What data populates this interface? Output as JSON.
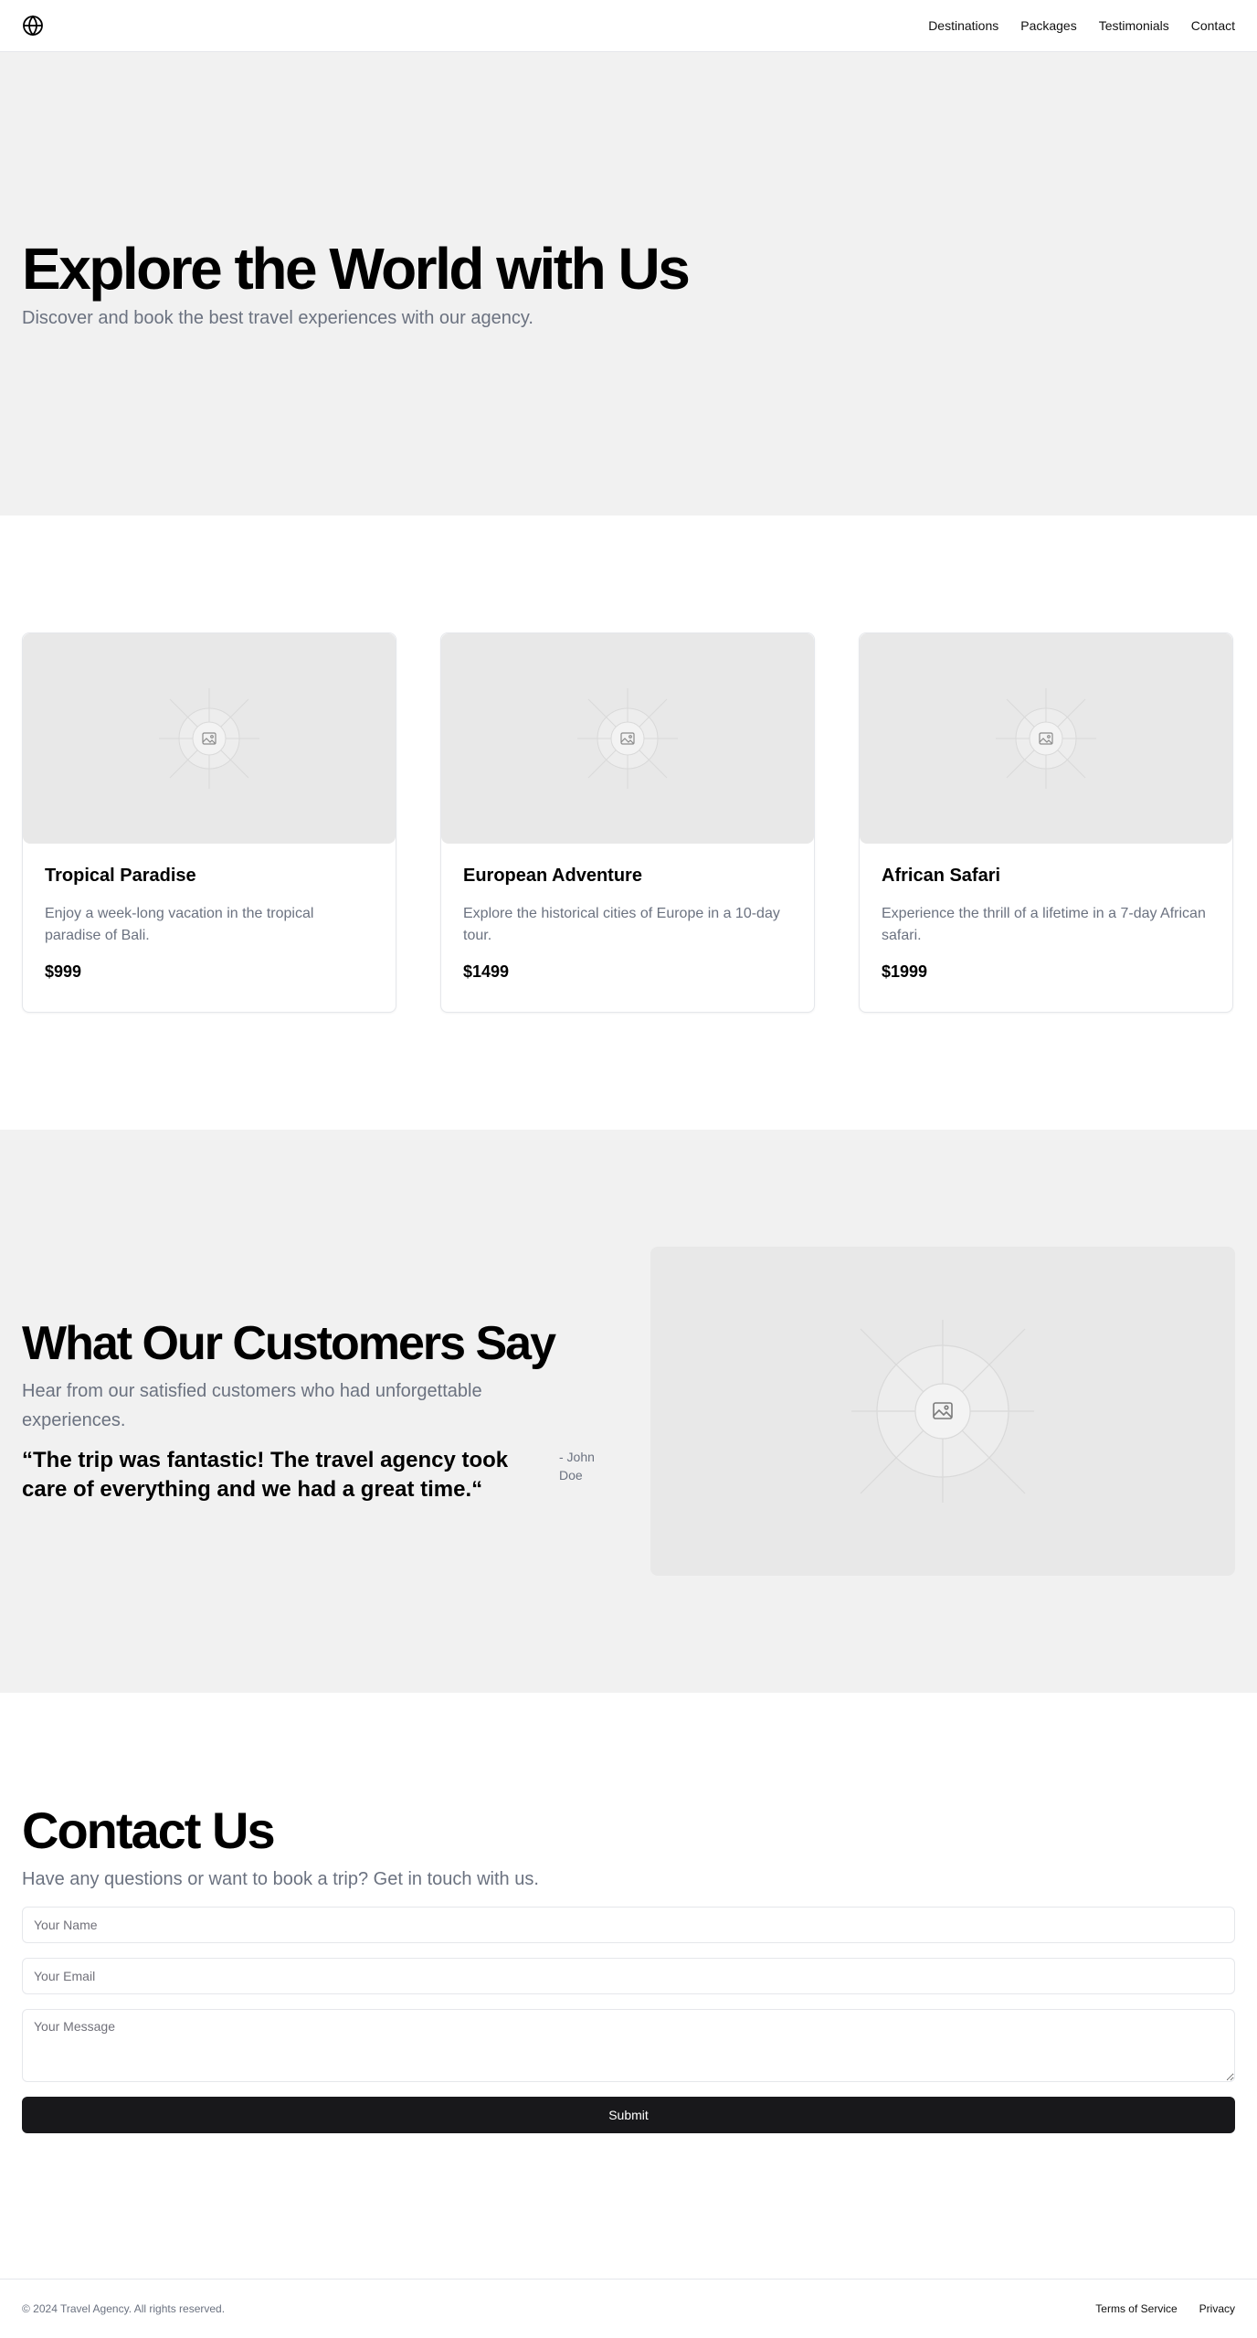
{
  "header": {
    "logo_icon": "globe-icon",
    "nav": [
      {
        "label": "Destinations"
      },
      {
        "label": "Packages"
      },
      {
        "label": "Testimonials"
      },
      {
        "label": "Contact"
      }
    ]
  },
  "hero": {
    "title": "Explore the World with Us",
    "subtitle": "Discover and book the best travel experiences with our agency."
  },
  "packages": [
    {
      "title": "Tropical Paradise",
      "description": "Enjoy a week-long vacation in the tropical paradise of Bali.",
      "price": "$999",
      "image_icon": "image-placeholder-icon"
    },
    {
      "title": "European Adventure",
      "description": "Explore the historical cities of Europe in a 10-day tour.",
      "price": "$1499",
      "image_icon": "image-placeholder-icon"
    },
    {
      "title": "African Safari",
      "description": "Experience the thrill of a lifetime in a 7-day African safari.",
      "price": "$1999",
      "image_icon": "image-placeholder-icon"
    }
  ],
  "testimonials": {
    "title": "What Our Customers Say",
    "subtitle": "Hear from our satisfied customers who had unforgettable experiences.",
    "quote": "“The trip was fantastic! The travel agency took care of everything and we had a great time.“",
    "author": "- John Doe",
    "image_icon": "image-placeholder-icon"
  },
  "contact": {
    "title": "Contact Us",
    "subtitle": "Have any questions or want to book a trip? Get in touch with us.",
    "name_placeholder": "Your Name",
    "email_placeholder": "Your Email",
    "message_placeholder": "Your Message",
    "submit_label": "Submit"
  },
  "footer": {
    "copyright": "© 2024 Travel Agency. All rights reserved.",
    "links": [
      {
        "label": "Terms of Service"
      },
      {
        "label": "Privacy"
      }
    ]
  },
  "colors": {
    "section_bg": "#f1f1f1",
    "placeholder_bg": "#e8e8e8",
    "button_bg": "#18181b",
    "muted_text": "#6b7280"
  }
}
